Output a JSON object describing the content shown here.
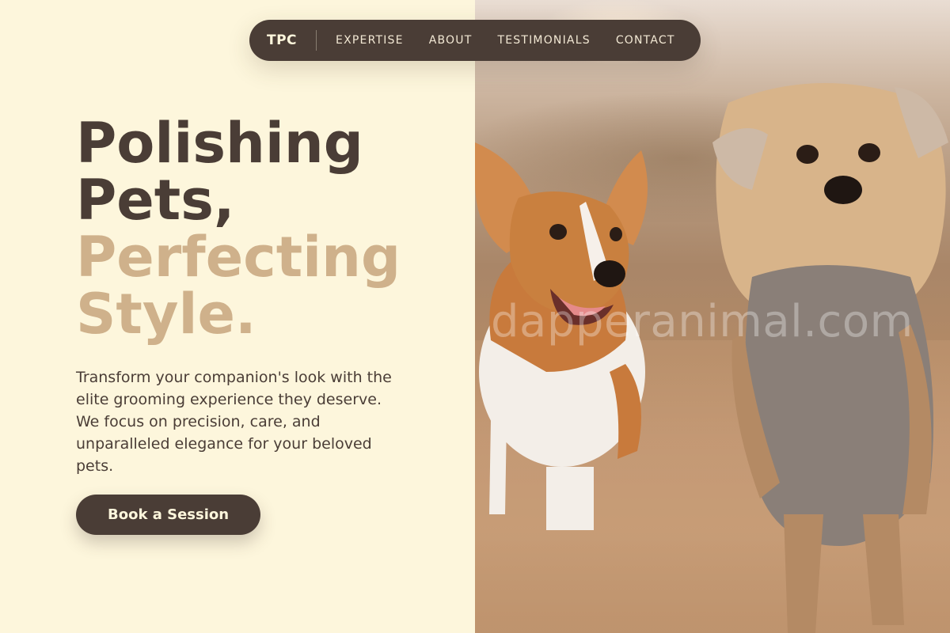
{
  "nav": {
    "brand": "TPC",
    "links": [
      {
        "label": "EXPERTISE"
      },
      {
        "label": "ABOUT"
      },
      {
        "label": "TESTIMONIALS"
      },
      {
        "label": "CONTACT"
      }
    ]
  },
  "hero": {
    "headline_line1": "Polishing",
    "headline_line2": "Pets,",
    "headline_accent1": "Perfecting",
    "headline_accent2": "Style.",
    "description": "Transform your companion's look with the elite grooming experience they deserve. We focus on precision, care, and unparalleled elegance for your beloved pets.",
    "cta_label": "Book a Session"
  },
  "image": {
    "watermark": "dapperanimal.com",
    "subject": "two dogs walking on a dirt path"
  },
  "colors": {
    "background": "#fdf6dc",
    "dark": "#4a3d36",
    "accent": "#cfb18b"
  }
}
